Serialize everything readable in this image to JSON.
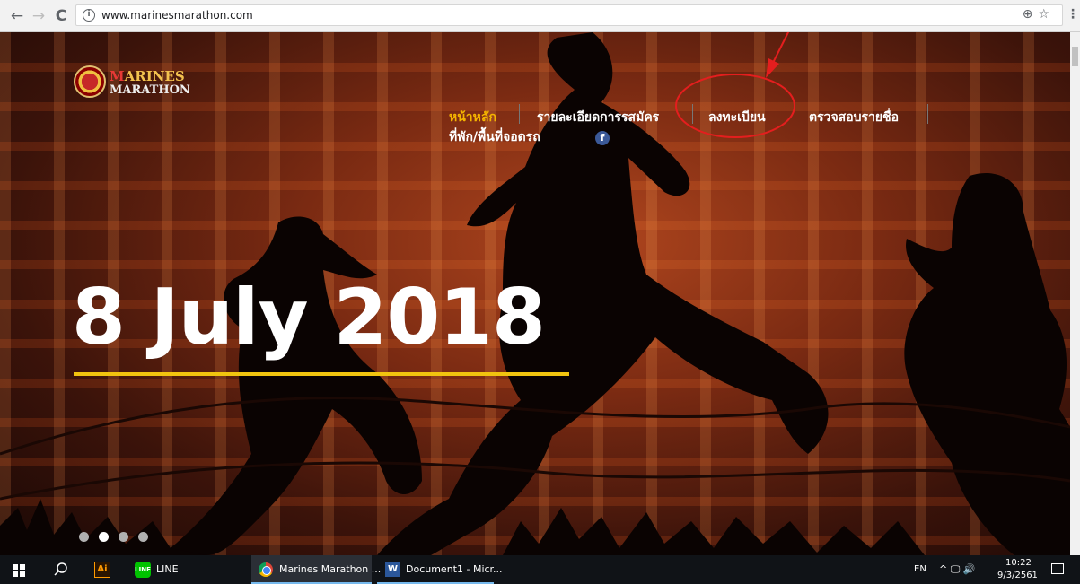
{
  "browser": {
    "back_icon": "←",
    "forward_icon": "→",
    "reload_icon": "C",
    "info_icon": "i",
    "url": "www.marinesmarathon.com",
    "zoom_icon": "⊕",
    "star_icon": "☆",
    "menu_icon": "⋮"
  },
  "site": {
    "logo": {
      "line1_cap": "M",
      "line1_rest": "ARINES",
      "line2": "MARATHON"
    },
    "nav": {
      "home": "หน้าหลัก",
      "details": "รายละเอียดการรสมัคร",
      "register": "ลงทะเบียน",
      "check_names": "ตรวจสอบรายชื่อ",
      "accommodation": "ที่พัก/พื้นที่จอดรถ",
      "facebook_icon": "f"
    },
    "headline": "8 July 2018",
    "carousel": {
      "slide_count": 4,
      "active_index": 1
    }
  },
  "colors": {
    "accent": "#f4b400",
    "headline_bar": "#f1c40f",
    "annotation": "#e41e1e",
    "facebook": "#3b5998"
  },
  "taskbar": {
    "adobe_label": "Ai",
    "line_icon_text": "LINE",
    "line_label": "LINE",
    "chrome_task": "Marines Marathon ...",
    "word_icon_text": "W",
    "word_task": "Document1 - Micr...",
    "language": "EN",
    "tray_icons": "^ 🖵 🔊",
    "time": "10:22",
    "date": "9/3/2561"
  }
}
